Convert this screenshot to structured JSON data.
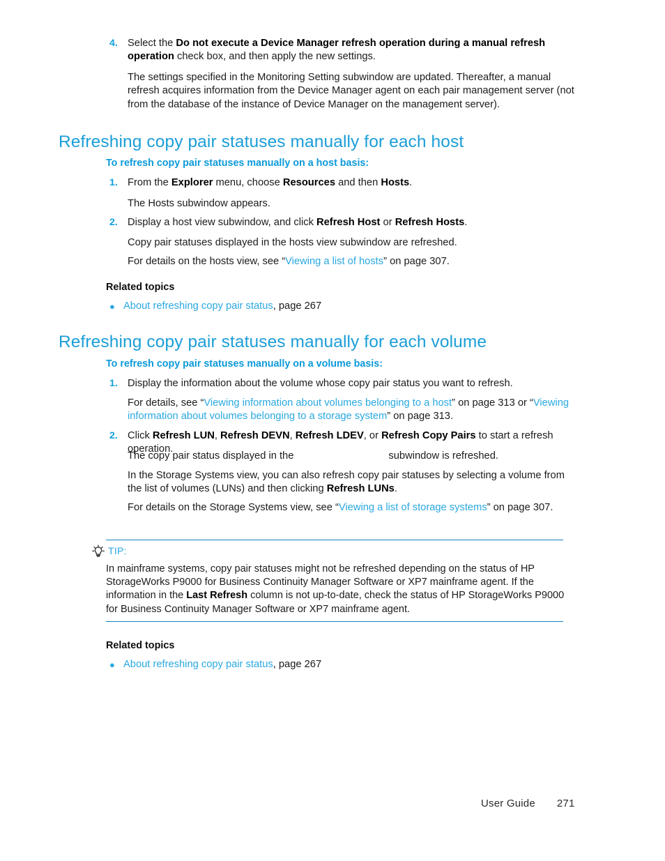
{
  "document": {
    "footer": {
      "label": "User Guide",
      "page_number": "271"
    }
  },
  "step4": {
    "number": "4.",
    "line1_pre": "Select the ",
    "line1_bold": "Do not execute a Device Manager refresh operation during a manual refresh operation",
    "line1_post": " check box, and then apply the new settings.",
    "paragraph": "The settings specified in the Monitoring Setting subwindow are updated. Thereafter, a manual refresh acquires information from the Device Manager agent on each pair management server (not from the database of the instance of Device Manager on the management server)."
  },
  "section_host": {
    "heading": "Refreshing copy pair statuses manually for each host",
    "subheading": "To refresh copy pair statuses manually on a host basis:",
    "steps": [
      {
        "number": "1.",
        "line_pre": "From the ",
        "bold1": "Explorer",
        "mid1": " menu, choose ",
        "bold2": "Resources",
        "mid2": " and then ",
        "bold3": "Hosts",
        "line_post": ".",
        "result": "The Hosts subwindow appears."
      },
      {
        "number": "2.",
        "line_pre": "Display a host view subwindow, and click ",
        "bold1": "Refresh Host",
        "mid1": " or ",
        "bold2": "Refresh Hosts",
        "line_post": ".",
        "result": "Copy pair statuses displayed in the hosts view subwindow are refreshed.",
        "details_pre": "For details on the hosts view, see “",
        "details_link": "Viewing a list of hosts",
        "details_post": "” on page 307."
      }
    ],
    "related_title": "Related topics",
    "related_items": [
      {
        "link": "About refreshing copy pair status",
        "suffix": ", page 267"
      }
    ]
  },
  "section_volume": {
    "heading": "Refreshing copy pair statuses manually for each volume",
    "subheading": "To refresh copy pair statuses manually on a volume basis:",
    "step1": {
      "number": "1.",
      "line": "Display the information about the volume whose copy pair status you want to refresh.",
      "details_pre": "For details, see “",
      "details_link1": "Viewing information about volumes belonging to a host",
      "details_mid": "” on page 313 or “",
      "details_link2": "Viewing information about volumes belonging to a storage system",
      "details_post": "” on page 313."
    },
    "step2": {
      "number": "2.",
      "line_pre": "Click ",
      "bold1": "Refresh LUN",
      "sep1": ", ",
      "bold2": "Refresh DEVN",
      "sep2": ", ",
      "bold3": "Refresh LDEV",
      "sep3": ", or ",
      "bold4": "Refresh Copy Pairs",
      "line_post": " to start a refresh operation.",
      "result_pre": "The copy pair status displayed in the",
      "result_gap": "",
      "result_post": "subwindow is refreshed.",
      "note_pre": "In the Storage Systems view, you can also refresh copy pair statuses by selecting a volume from the list of volumes (LUNs) and then clicking ",
      "note_bold": "Refresh LUNs",
      "note_post": ".",
      "details_pre": "For details on the Storage Systems view, see “",
      "details_link": "Viewing a list of storage systems",
      "details_post": "” on page 307."
    },
    "related_title": "Related topics",
    "related_items": [
      {
        "link": "About refreshing copy pair status",
        "suffix": ", page 267"
      }
    ]
  },
  "tip": {
    "icon": "lightbulb-icon",
    "label": "TIP:",
    "line1": "In mainframe systems, copy pair statuses might not be refreshed depending on the status of HP",
    "line2": "StorageWorks P9000 for Business Continuity Manager Software or XP7 mainframe agent. If the",
    "line3_pre": "information in the ",
    "line3_bold": "Last Refresh",
    "line3_post": " column is not up-to-date, check the status of HP StorageWorks P9000",
    "line4": "for Business Continuity Manager Software or XP7 mainframe agent."
  },
  "colors": {
    "heading_blue": "#1b9ed8",
    "subheading_blue": "#0c9ad9",
    "link_blue": "#2aa8e0",
    "rule_blue": "#1181bb",
    "body_black": "#1b1b1b"
  }
}
